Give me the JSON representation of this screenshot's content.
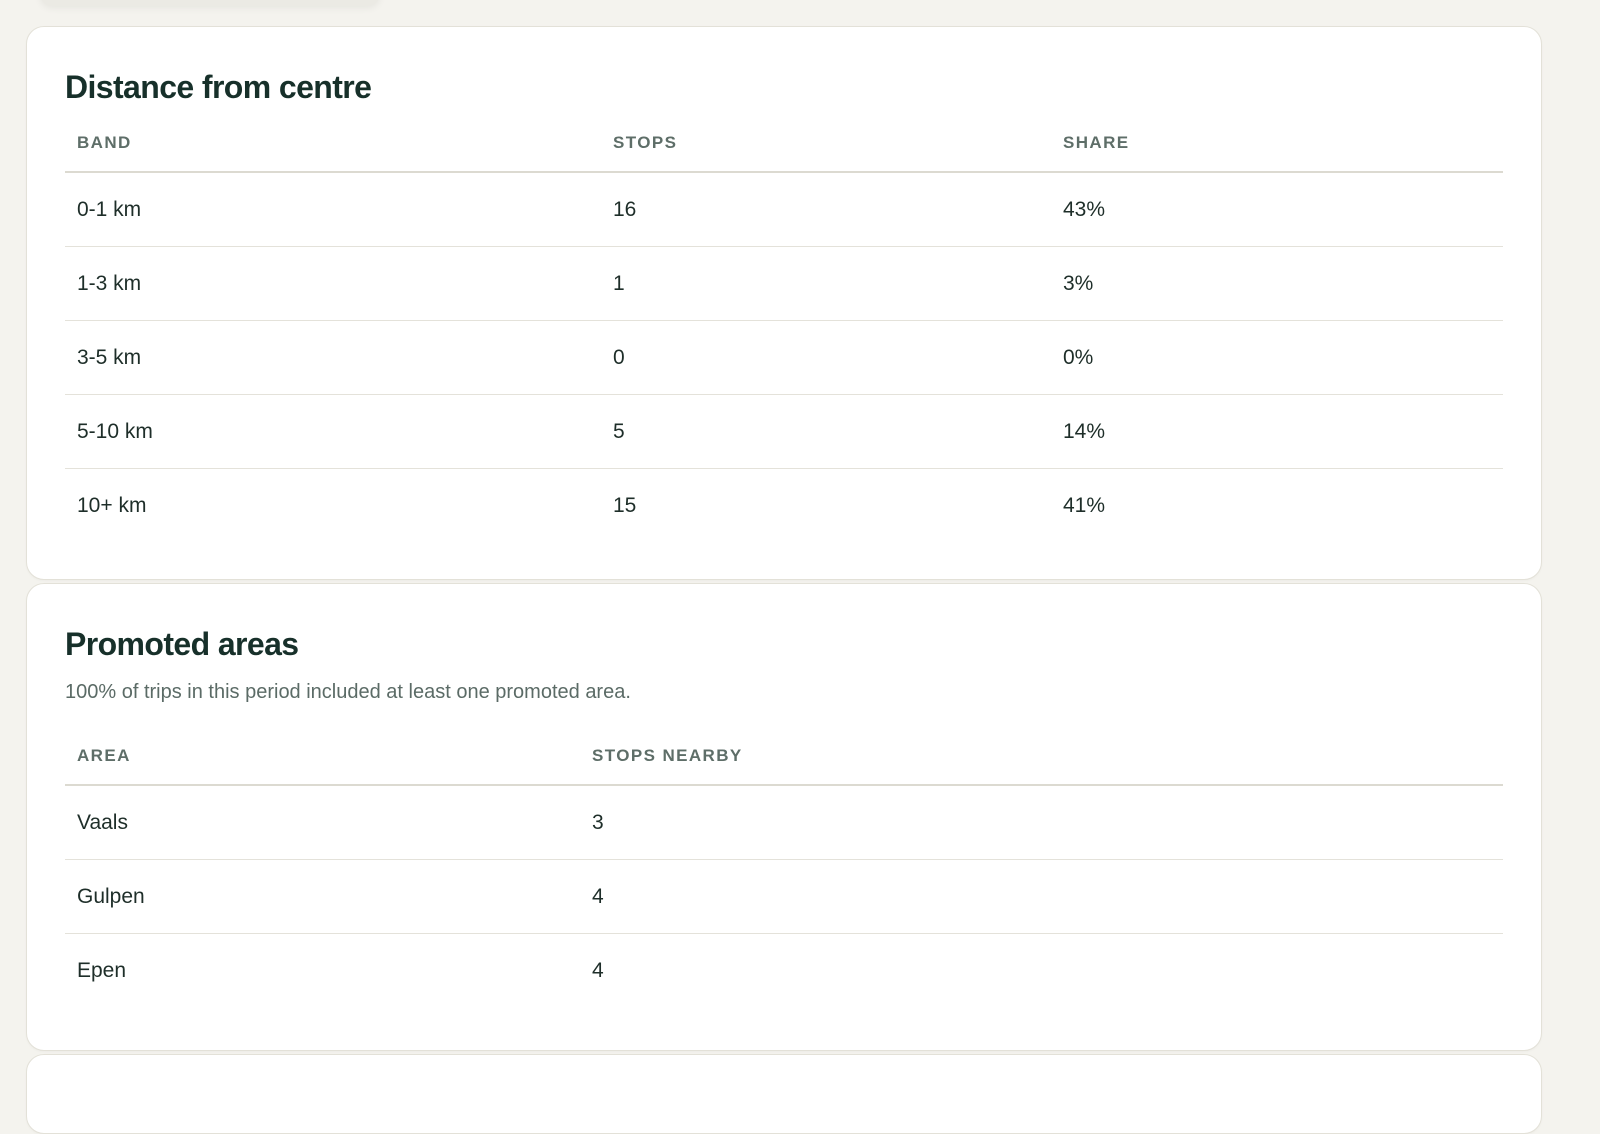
{
  "distance": {
    "title": "Distance from centre",
    "headers": [
      "BAND",
      "STOPS",
      "SHARE"
    ],
    "rows": [
      {
        "band": "0-1 km",
        "stops": "16",
        "share": "43%"
      },
      {
        "band": "1-3 km",
        "stops": "1",
        "share": "3%"
      },
      {
        "band": "3-5 km",
        "stops": "0",
        "share": "0%"
      },
      {
        "band": "5-10 km",
        "stops": "5",
        "share": "14%"
      },
      {
        "band": "10+ km",
        "stops": "15",
        "share": "41%"
      }
    ]
  },
  "promoted": {
    "title": "Promoted areas",
    "description": "100% of trips in this period included at least one promoted area.",
    "headers": [
      "AREA",
      "STOPS NEARBY"
    ],
    "rows": [
      {
        "area": "Vaals",
        "stops": "3"
      },
      {
        "area": "Gulpen",
        "stops": "4"
      },
      {
        "area": "Epen",
        "stops": "4"
      }
    ]
  }
}
